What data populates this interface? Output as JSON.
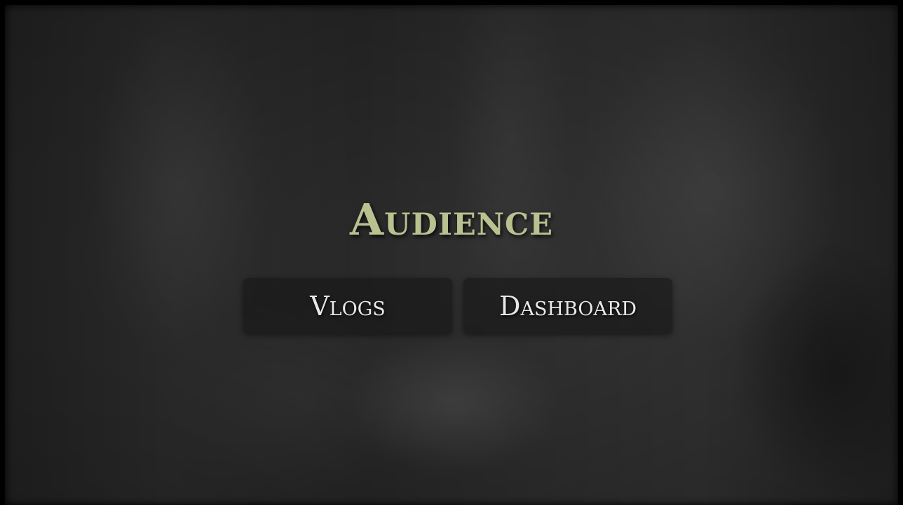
{
  "page": {
    "title": "Audience"
  },
  "menu": {
    "vlogs_label": "Vlogs",
    "dashboard_label": "Dashboard"
  },
  "colors": {
    "title": "#b9c190",
    "button_text": "#e8e8e8",
    "button_bg": "#161616"
  }
}
